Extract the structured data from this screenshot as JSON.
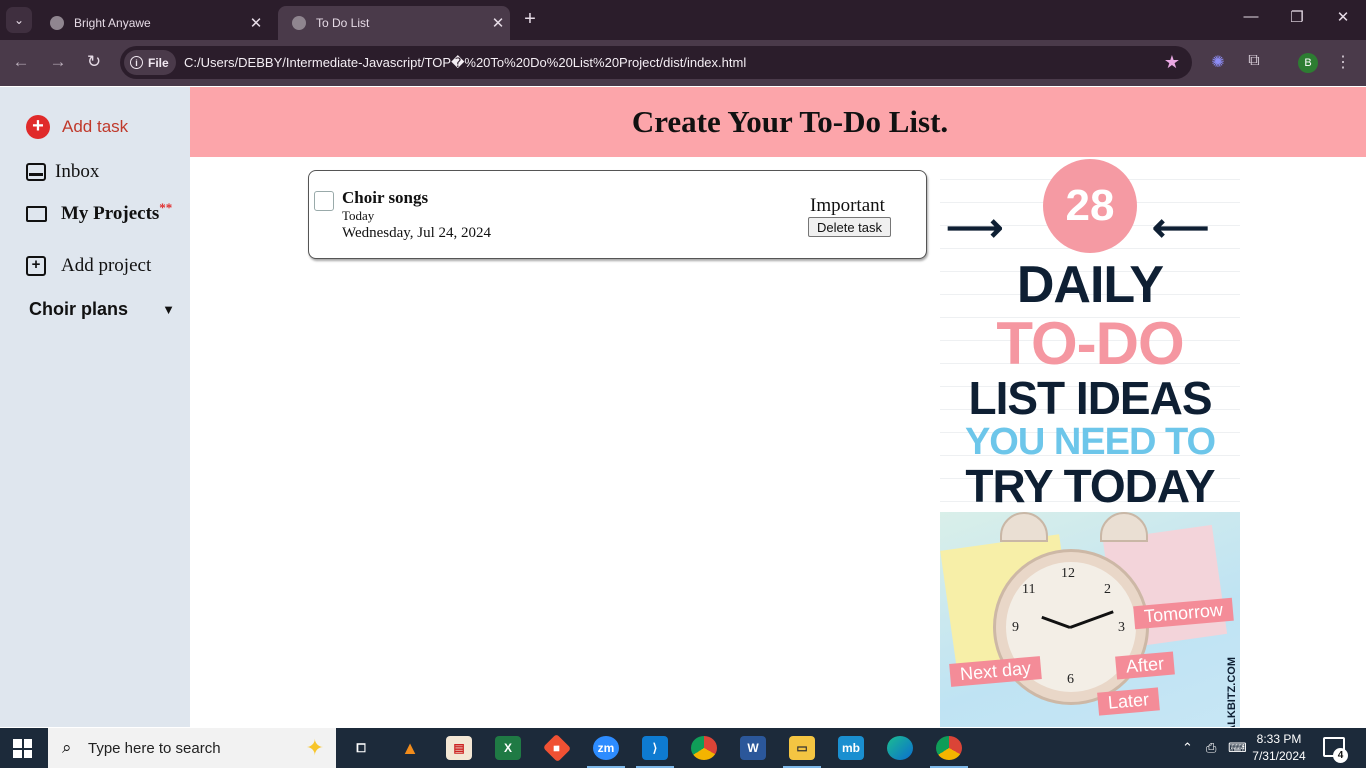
{
  "browser": {
    "tabs": [
      {
        "title": "Bright Anyawe",
        "active": false
      },
      {
        "title": "To Do List",
        "active": true
      }
    ],
    "address_chip": "File",
    "url": "C:/Users/DEBBY/Intermediate-Javascript/TOP�%20To%20Do%20List%20Project/dist/index.html",
    "profile_initial": "B",
    "new_tab_symbol": "+",
    "close_symbol": "✕"
  },
  "sidebar": {
    "add_task": "Add task",
    "inbox": "Inbox",
    "my_projects": "My Projects",
    "my_projects_marker": "**",
    "add_project": "Add project",
    "project_group": "Choir plans"
  },
  "header": {
    "title": "Create Your To-Do List."
  },
  "task": {
    "title": "Choir songs",
    "when": "Today",
    "date": "Wednesday, Jul 24, 2024",
    "priority": "Important",
    "delete_label": "Delete task",
    "completed": false
  },
  "poster": {
    "number": "28",
    "line1": "DAILY",
    "line2": "TO-DO",
    "line3": "LIST IDEAS",
    "line4": "YOU NEED TO",
    "line5": "TRY TODAY",
    "tags": [
      "Tomorrow",
      "Next day",
      "After",
      "Later"
    ],
    "credit": "ALKBITZ.COM",
    "colors": {
      "navy": "#0e1f33",
      "pink": "#f597a1",
      "blue": "#6dc6ea"
    }
  },
  "taskbar": {
    "search_placeholder": "Type here to search",
    "time": "8:33 PM",
    "date": "7/31/2024",
    "notification_count": "4",
    "apps": [
      "task-view",
      "vlc",
      "media-app",
      "excel",
      "git-app",
      "zoom",
      "vscode",
      "chrome",
      "word",
      "file-explorer",
      "mb-app",
      "edge",
      "chrome-active"
    ]
  },
  "colors": {
    "header_bg": "#fca5aa",
    "sidebar_bg": "#dfe6ee",
    "add_task_accent": "#e02a2a",
    "browser_frame": "#2b1d2b"
  }
}
